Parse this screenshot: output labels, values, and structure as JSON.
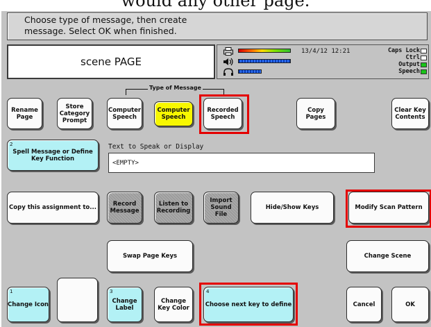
{
  "top_caption": "would any other page.",
  "instructions": {
    "line1": "Choose type of message, then create",
    "line2": "message.  Select OK when finished."
  },
  "page_title": "scene PAGE",
  "status": {
    "datetime": "13/4/12 12:21",
    "indicators": [
      {
        "label": "Caps Lock",
        "on": false
      },
      {
        "label": "Ctrl",
        "on": false
      },
      {
        "label": "Output",
        "on": true
      },
      {
        "label": "Speech",
        "on": true
      }
    ],
    "icons": [
      "printer-icon",
      "speaker-icon",
      "headphones-icon"
    ],
    "volume_level": 1.0,
    "headphone_level": 0.45
  },
  "type_group_label": "Type of Message",
  "buttons": {
    "rename_page": "Rename Page",
    "store_category_prompt": "Store Category Prompt",
    "computer_speech": "Computer Speech",
    "computer_speech_selected": "Computer Speech",
    "recorded_speech": "Recorded Speech",
    "copy_pages": "Copy Pages",
    "clear_key_contents": "Clear Key Contents",
    "spell_message": "Spell Message or Define Key Function",
    "spell_message_num": "2",
    "copy_assignment": "Copy this assignment to...",
    "record_message": "Record Message",
    "listen_to_recording": "Listen to Recording",
    "import_sound_file": "Import Sound File",
    "hide_show_keys": "Hide/Show Keys",
    "modify_scan_pattern": "Modify Scan Pattern",
    "swap_page_keys": "Swap Page Keys",
    "change_scene": "Change Scene",
    "change_icon": "Change Icon",
    "change_icon_num": "1",
    "change_label": "Change Label",
    "change_label_num": "3",
    "change_key_color": "Change Key Color",
    "choose_next_key": "Choose next key to define",
    "choose_next_key_num": "4",
    "cancel": "Cancel",
    "ok": "OK"
  },
  "tts": {
    "label": "Text to Speak or Display",
    "value": "<EMPTY>"
  },
  "colors": {
    "background": "#c3c3c3",
    "highlight": "#e40000",
    "cyan_button": "#b3f1f5",
    "selected_button": "#f7f700",
    "disabled_button": "#9c9c9c",
    "indicator_on": "#19c419"
  }
}
